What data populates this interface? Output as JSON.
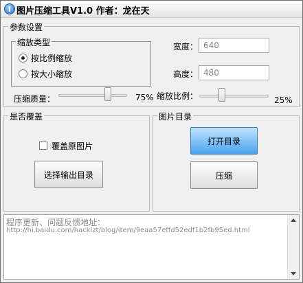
{
  "window": {
    "title": "图片压缩工具V1.0   作者：龙在天"
  },
  "params": {
    "legend": "参数设置",
    "zoom_type": {
      "legend": "缩放类型",
      "options": [
        "按比例缩放",
        "按大小缩放"
      ],
      "selected": "按比例缩放"
    },
    "width": {
      "label": "宽度：",
      "value": "640"
    },
    "height": {
      "label": "高度：",
      "value": "480"
    },
    "quality": {
      "label": "压缩质量：",
      "value_text": "75%",
      "value": 75
    },
    "scale": {
      "label": "缩放比例：",
      "value_text": "25%",
      "value": 25
    }
  },
  "overwrite": {
    "legend": "是否覆盖",
    "checkbox_label": "覆盖原图片",
    "checked": false,
    "output_button": "选择输出目录"
  },
  "image_dir": {
    "legend": "图片目录",
    "open_button": "打开目录",
    "compress_button": "压缩"
  },
  "log": {
    "lines": [
      "程序更新、问题反馈地址：",
      "http://hi.baidu.com/hacklzt/blog/item/9eaa57effd52edf1b2fb95ed.html"
    ]
  }
}
